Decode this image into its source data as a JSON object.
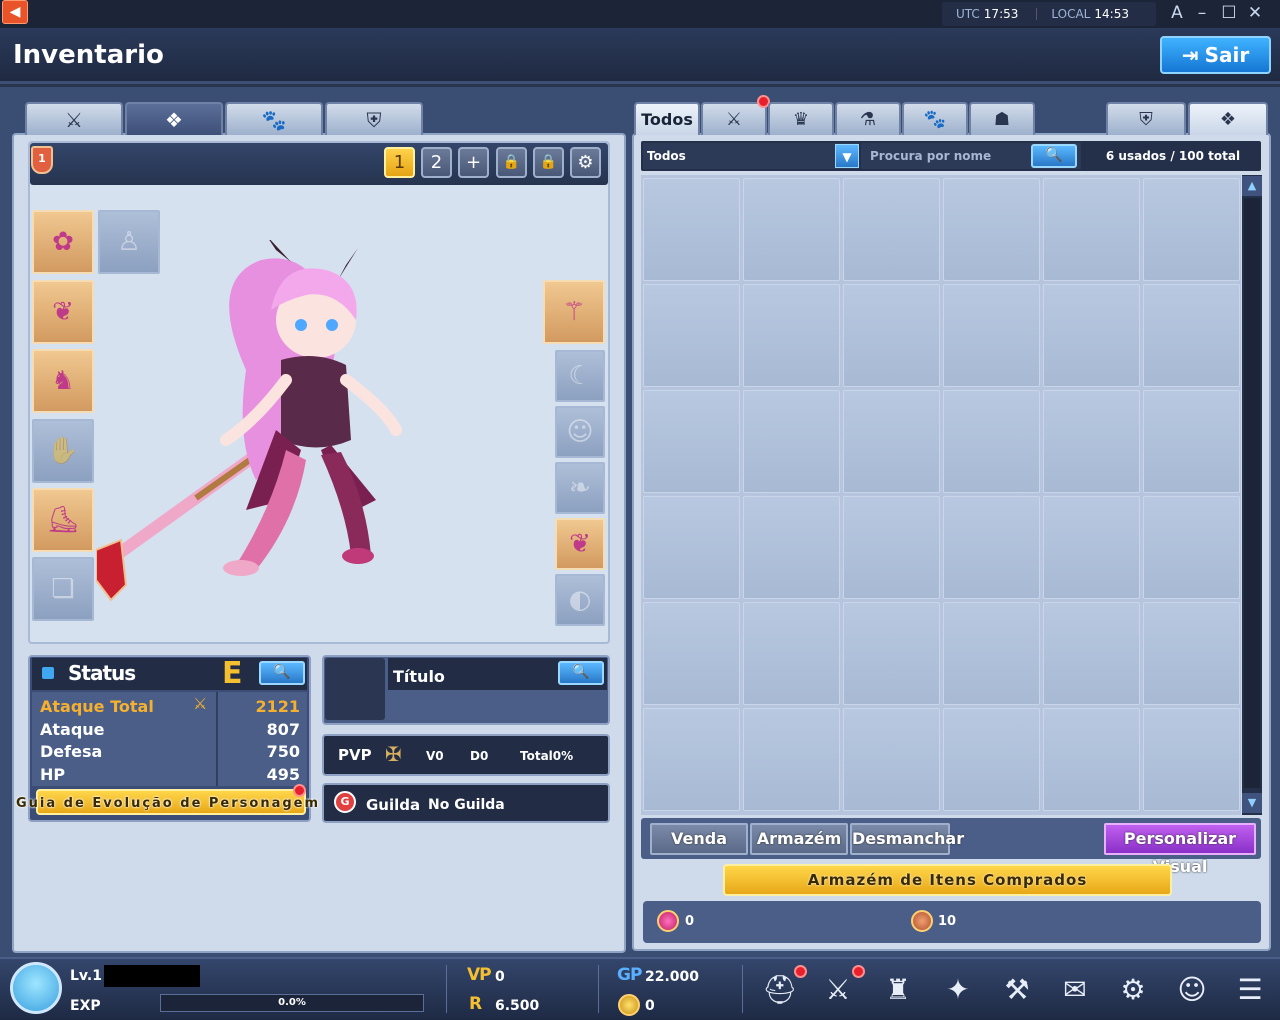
{
  "titlebar": {
    "utc_label": "UTC",
    "utc_time": "17:53",
    "local_label": "LOCAL",
    "local_time": "14:53",
    "btn_font": "A",
    "btn_min": "–",
    "btn_max": "☐",
    "btn_close": "✕"
  },
  "header": {
    "title": "Inventario",
    "exit_label": "Sair"
  },
  "equip": {
    "badge": "1",
    "slots": [
      "1",
      "2"
    ],
    "add": "+",
    "lock1": "🔒",
    "lock2": "🔒",
    "gear": "⚙"
  },
  "status": {
    "title": "Status",
    "grade": "E",
    "search": "🔍",
    "rows": [
      {
        "label": "Ataque Total",
        "value": "2121"
      },
      {
        "label": "Ataque",
        "value": "807"
      },
      {
        "label": "Defesa",
        "value": "750"
      },
      {
        "label": "HP",
        "value": "495"
      }
    ],
    "guide_label": "Guia de Evolução de Personagem"
  },
  "title_panel": {
    "label": "Título",
    "search": "🔍"
  },
  "pvp": {
    "label": "PVP",
    "victories": "V0",
    "defeats": "D0",
    "total": "Total0%"
  },
  "guild": {
    "icon_letter": "G",
    "label": "Guilda",
    "value": "No Guilda"
  },
  "inventory": {
    "tabs": [
      "Todos"
    ],
    "filter_selected": "Todos",
    "search_placeholder": "Procura por nome",
    "capacity": "6 usados / 100 total",
    "actions": {
      "sell": "Venda",
      "store": "Armazém",
      "dismantle": "Desmanchar",
      "customize": "Personalizar Visual"
    },
    "bought_items": "Armazém de Itens Comprados",
    "coin1_value": "0",
    "coin2_value": "10"
  },
  "bottom": {
    "level": "Lv.1",
    "exp_label": "EXP",
    "exp_percent": "0.0%",
    "vp_label": "VP",
    "vp_value": "0",
    "r_label": "R",
    "r_value": "6.500",
    "gp_label": "GP",
    "gp_value": "22.000",
    "coin_value": "0"
  },
  "colors": {
    "accent_blue": "#2878c8",
    "gold": "#f5c030",
    "panel": "#cfdaea",
    "purple_button": "#a040e0"
  }
}
